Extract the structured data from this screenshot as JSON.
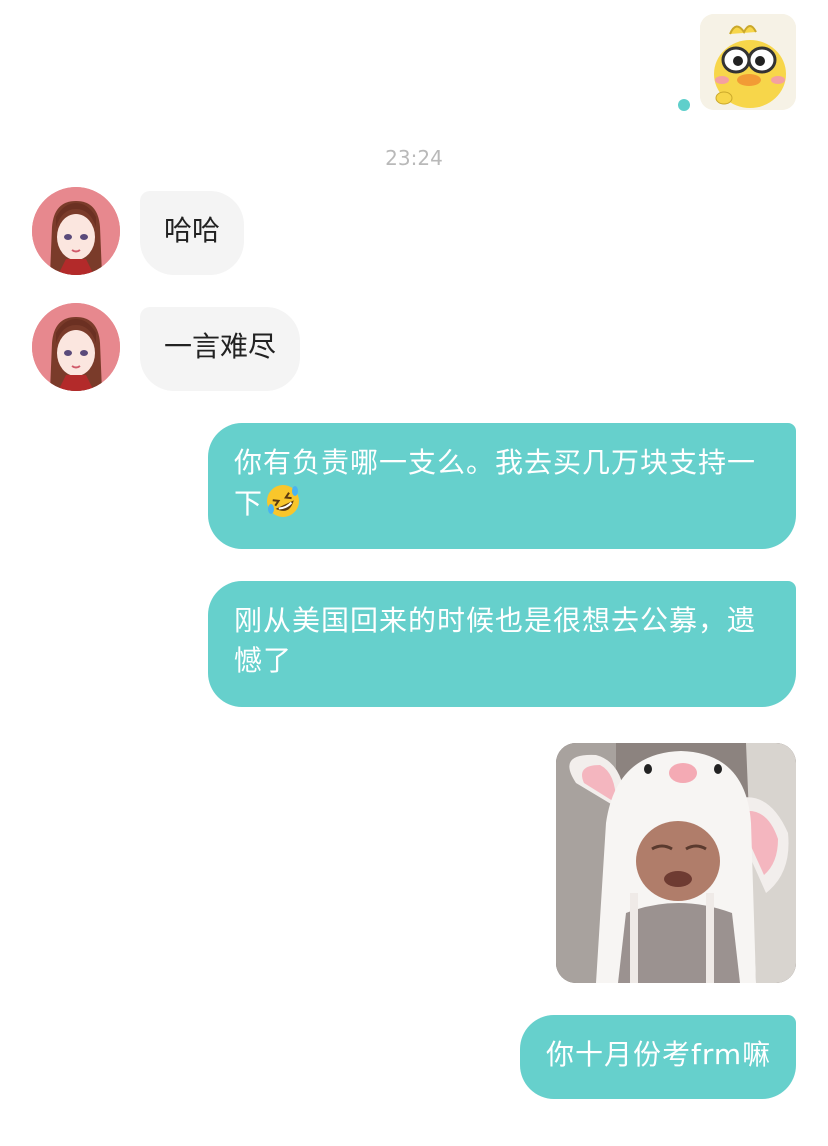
{
  "chat": {
    "timestamp": "23:24",
    "messages": [
      {
        "side": "in",
        "type": "text",
        "text": "哈哈"
      },
      {
        "side": "in",
        "type": "text",
        "text": "一言难尽"
      },
      {
        "side": "out",
        "type": "text",
        "text": "你有负责哪一支么。我去买几万块支持一下",
        "emoji": "rolling-laughing-emoji"
      },
      {
        "side": "out",
        "type": "text",
        "text": "刚从美国回来的时候也是很想去公募，遗憾了"
      },
      {
        "side": "out",
        "type": "image",
        "image": "baby-in-bunny-hat-sticker"
      },
      {
        "side": "out",
        "type": "text",
        "text": "你十月份考frm嘛"
      }
    ]
  },
  "colors": {
    "outgoing_bubble": "#66d0cc",
    "incoming_bubble": "#f4f4f4",
    "avatar_bg": "#e7888e",
    "status_dot": "#5fcfcb"
  }
}
